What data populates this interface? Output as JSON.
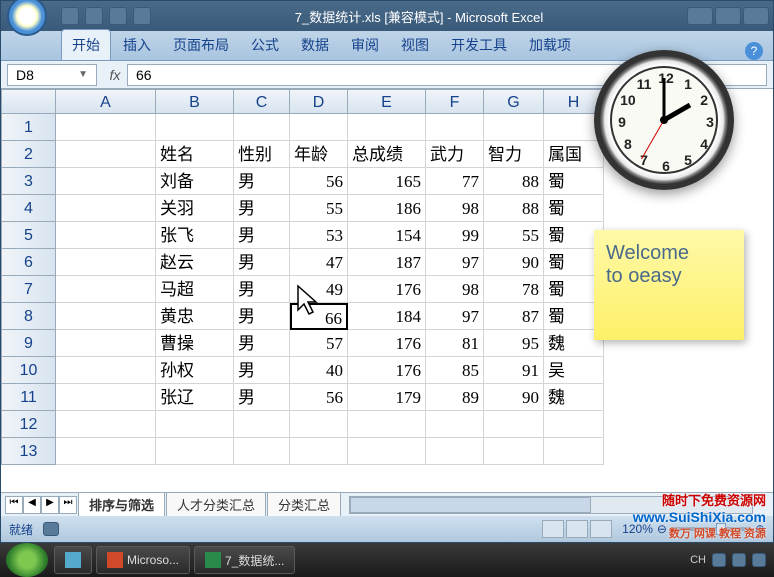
{
  "title": "7_数据统计.xls  [兼容模式] - Microsoft Excel",
  "ribbon": {
    "tabs": [
      "开始",
      "插入",
      "页面布局",
      "公式",
      "数据",
      "审阅",
      "视图",
      "开发工具",
      "加载项"
    ],
    "active": 0
  },
  "formula_bar": {
    "name_box": "D8",
    "fx": "fx",
    "value": "66"
  },
  "columns": [
    "A",
    "B",
    "C",
    "D",
    "E",
    "F",
    "G",
    "H"
  ],
  "rows_shown": 13,
  "headers_row": [
    "",
    "姓名",
    "性别",
    "年龄",
    "总成绩",
    "武力",
    "智力",
    "属国"
  ],
  "data_rows": [
    [
      "",
      "刘备",
      "男",
      "56",
      "165",
      "77",
      "88",
      "蜀"
    ],
    [
      "",
      "关羽",
      "男",
      "55",
      "186",
      "98",
      "88",
      "蜀"
    ],
    [
      "",
      "张飞",
      "男",
      "53",
      "154",
      "99",
      "55",
      "蜀"
    ],
    [
      "",
      "赵云",
      "男",
      "47",
      "187",
      "97",
      "90",
      "蜀"
    ],
    [
      "",
      "马超",
      "男",
      "49",
      "176",
      "98",
      "78",
      "蜀"
    ],
    [
      "",
      "黄忠",
      "男",
      "66",
      "184",
      "97",
      "87",
      "蜀"
    ],
    [
      "",
      "曹操",
      "男",
      "57",
      "176",
      "81",
      "95",
      "魏"
    ],
    [
      "",
      "孙权",
      "男",
      "40",
      "176",
      "85",
      "91",
      "吴"
    ],
    [
      "",
      "张辽",
      "男",
      "56",
      "179",
      "89",
      "90",
      "魏"
    ]
  ],
  "active_cell": {
    "row": 8,
    "col": "D"
  },
  "sheet_tabs": [
    "排序与筛选",
    "人才分类汇总",
    "分类汇总"
  ],
  "active_sheet": 0,
  "status": {
    "text": "就绪",
    "zoom": "120%"
  },
  "taskbar": {
    "items": [
      {
        "icon": "ppt",
        "label": "Microso..."
      },
      {
        "icon": "xls",
        "label": "7_数据统..."
      }
    ],
    "ime": "CH"
  },
  "sticky_note": {
    "line1": "Welcome",
    "line2": "to oeasy"
  },
  "clock": {
    "numbers": [
      "12",
      "1",
      "2",
      "3",
      "4",
      "5",
      "6",
      "7",
      "8",
      "9",
      "10",
      "11"
    ]
  },
  "watermark": {
    "line1": "随时下免费资源网",
    "url": "www.SuiShiXia.com",
    "line3": "数万 网课 教程 资源"
  }
}
